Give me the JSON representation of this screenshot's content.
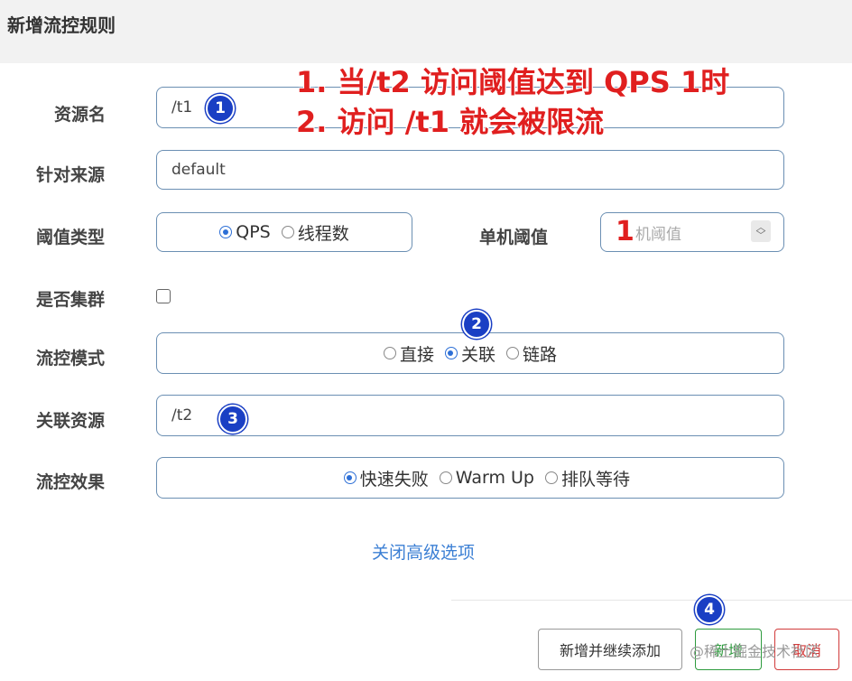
{
  "dialog": {
    "title": "新增流控规则"
  },
  "form": {
    "resource": {
      "label": "资源名",
      "value": "/t1"
    },
    "source": {
      "label": "针对来源",
      "value": "default"
    },
    "threshold_type": {
      "label": "阈值类型",
      "options": [
        "QPS",
        "线程数"
      ],
      "selected": "QPS"
    },
    "single_threshold": {
      "label": "单机阈值",
      "placeholder": "单机阈值",
      "visible_text": "机阈值"
    },
    "cluster": {
      "label": "是否集群",
      "checked": false
    },
    "flow_mode": {
      "label": "流控模式",
      "options": [
        "直接",
        "关联",
        "链路"
      ],
      "selected": "关联"
    },
    "ref_resource": {
      "label": "关联资源",
      "value": "/t2"
    },
    "effect": {
      "label": "流控效果",
      "options": [
        "快速失败",
        "Warm Up",
        "排队等待"
      ],
      "selected": "快速失败"
    },
    "advanced_link": "关闭高级选项"
  },
  "buttons": {
    "continue": "新增并继续添加",
    "add": "新增",
    "cancel": "取消"
  },
  "annotations": {
    "line1": "1. 当/t2 访问阈值达到 QPS 1时",
    "line2": "2. 访问 /t1 就会被限流",
    "red_one": "1",
    "badges": [
      "1",
      "2",
      "3",
      "4"
    ]
  },
  "watermark": "@稀土掘金技术社区",
  "colors": {
    "accent": "#2d6fd6",
    "link": "#3b7fd4",
    "add_green": "#2e9b3e",
    "cancel_red": "#d23b3b",
    "annotation_red": "#e01f1f",
    "badge_blue": "#1a3fc4"
  }
}
